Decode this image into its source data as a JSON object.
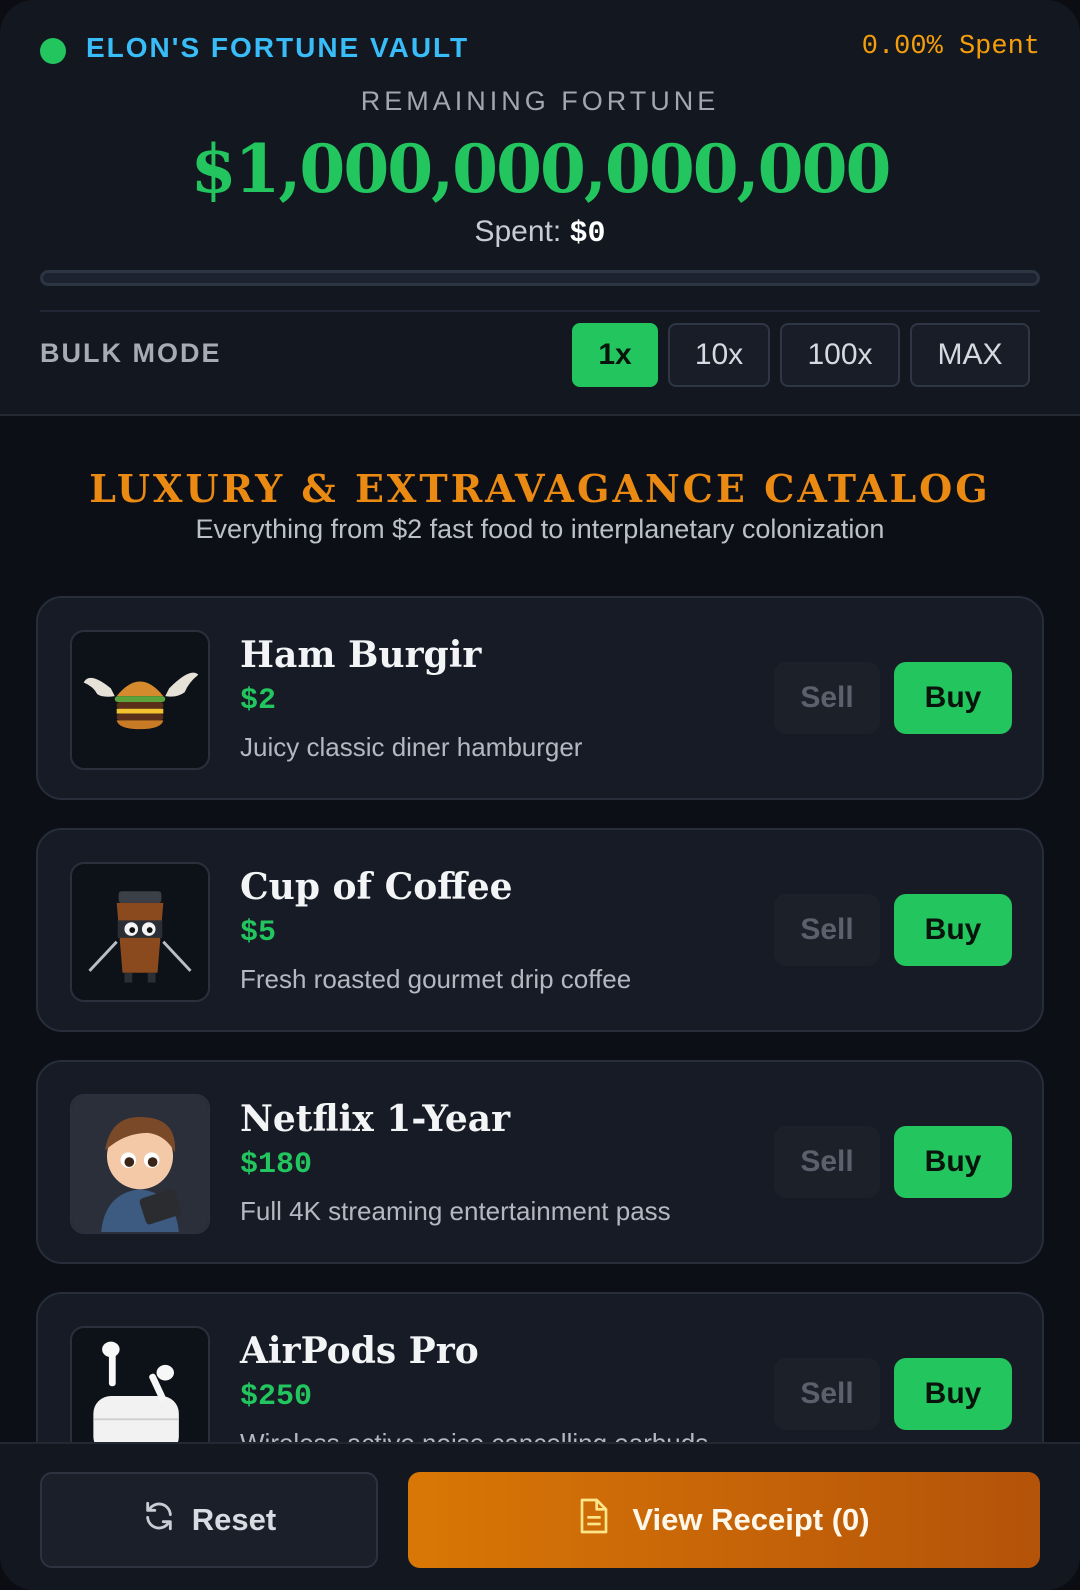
{
  "header": {
    "title": "ELON'S FORTUNE VAULT",
    "spent_percent": "0.00% Spent",
    "remaining_label": "REMAINING FORTUNE",
    "remaining_amount": "$1,000,000,000,000",
    "spent_label": "Spent:",
    "spent_value": "$0",
    "progress_fraction": 0,
    "status_color": "#22c55e"
  },
  "bulk_mode": {
    "label": "BULK MODE",
    "options": [
      "1x",
      "10x",
      "100x",
      "MAX"
    ],
    "selected": "1x"
  },
  "catalog": {
    "title": "LUXURY & EXTRAVAGANCE CATALOG",
    "subtitle": "Everything from $2 fast food to interplanetary colonization",
    "items": [
      {
        "name": "Ham Burgir",
        "price": "$2",
        "description": "Juicy classic diner hamburger",
        "icon": "winged-burger-icon",
        "sell_label": "Sell",
        "buy_label": "Buy"
      },
      {
        "name": "Cup of Coffee",
        "price": "$5",
        "description": "Fresh roasted gourmet drip coffee",
        "icon": "ninja-coffee-cup-icon",
        "sell_label": "Sell",
        "buy_label": "Buy"
      },
      {
        "name": "Netflix 1-Year",
        "price": "$180",
        "description": "Full 4K streaming entertainment pass",
        "icon": "boy-with-tablet-icon",
        "sell_label": "Sell",
        "buy_label": "Buy"
      },
      {
        "name": "AirPods Pro",
        "price": "$250",
        "description": "Wireless active noise cancelling earbuds",
        "icon": "airpods-icon",
        "sell_label": "Sell",
        "buy_label": "Buy"
      }
    ]
  },
  "footer": {
    "reset_label": "Reset",
    "receipt_label": "View Receipt (0)"
  },
  "colors": {
    "accent_green": "#22c55e",
    "accent_orange": "#ea8a12",
    "title_blue": "#38bdf8"
  }
}
